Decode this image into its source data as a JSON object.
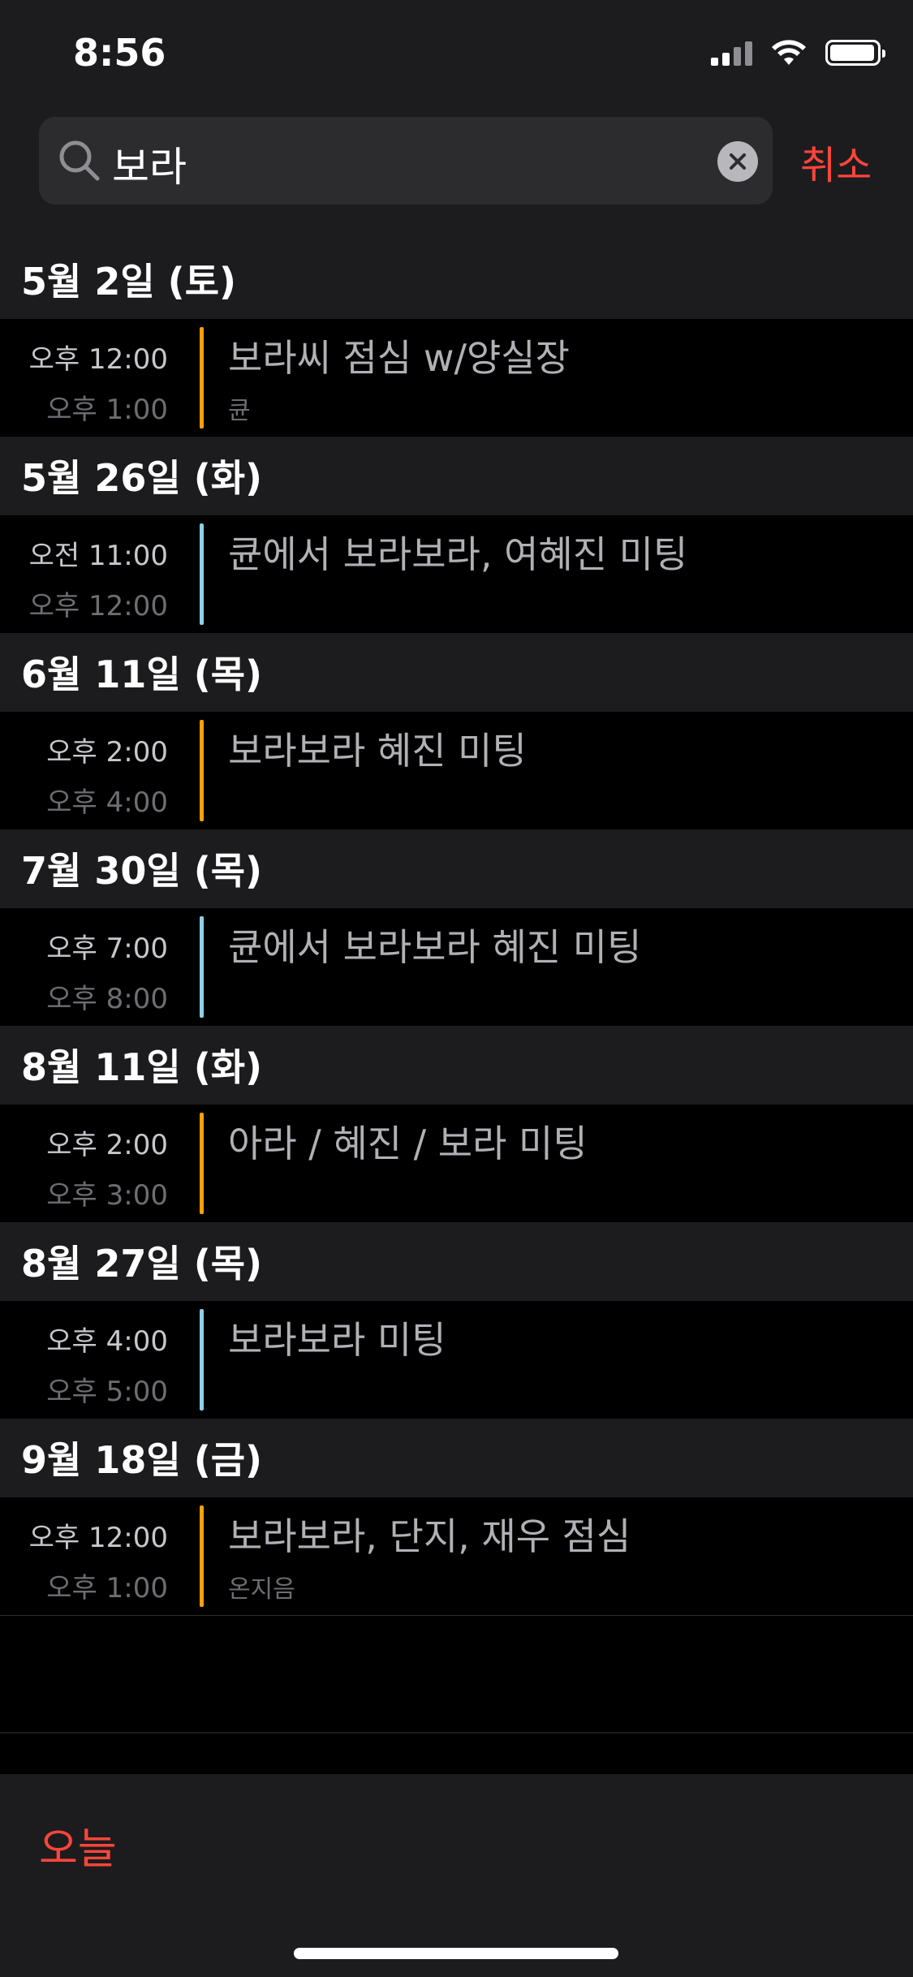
{
  "status_bar": {
    "time": "8:56"
  },
  "search": {
    "query": "보라",
    "cancel_label": "취소"
  },
  "colors": {
    "accent": "#ff453a",
    "cal_orange": "#ff9f0a",
    "cal_blue": "#8fd0e6"
  },
  "sections": [
    {
      "date": "5월 2일 (토)",
      "events": [
        {
          "start": "오후 12:00",
          "end": "오후 1:00",
          "title": "보라씨 점심 w/양실장",
          "location": "큔",
          "calendar_color": "#ff9f0a"
        }
      ]
    },
    {
      "date": "5월 26일 (화)",
      "events": [
        {
          "start": "오전 11:00",
          "end": "오후 12:00",
          "title": "큔에서 보라보라, 여혜진 미팅",
          "location": "",
          "calendar_color": "#8fd0e6"
        }
      ]
    },
    {
      "date": "6월 11일 (목)",
      "events": [
        {
          "start": "오후 2:00",
          "end": "오후 4:00",
          "title": "보라보라 혜진 미팅",
          "location": "",
          "calendar_color": "#ff9f0a"
        }
      ]
    },
    {
      "date": "7월 30일 (목)",
      "events": [
        {
          "start": "오후 7:00",
          "end": "오후 8:00",
          "title": "큔에서 보라보라 혜진 미팅",
          "location": "",
          "calendar_color": "#8fd0e6"
        }
      ]
    },
    {
      "date": "8월 11일 (화)",
      "events": [
        {
          "start": "오후 2:00",
          "end": "오후 3:00",
          "title": "아라 / 혜진 / 보라 미팅",
          "location": "",
          "calendar_color": "#ff9f0a"
        }
      ]
    },
    {
      "date": "8월 27일 (목)",
      "events": [
        {
          "start": "오후 4:00",
          "end": "오후 5:00",
          "title": "보라보라 미팅",
          "location": "",
          "calendar_color": "#8fd0e6"
        }
      ]
    },
    {
      "date": "9월 18일 (금)",
      "events": [
        {
          "start": "오후 12:00",
          "end": "오후 1:00",
          "title": "보라보라, 단지, 재우 점심",
          "location": "온지음",
          "calendar_color": "#ff9f0a"
        }
      ]
    }
  ],
  "toolbar": {
    "today_label": "오늘"
  }
}
